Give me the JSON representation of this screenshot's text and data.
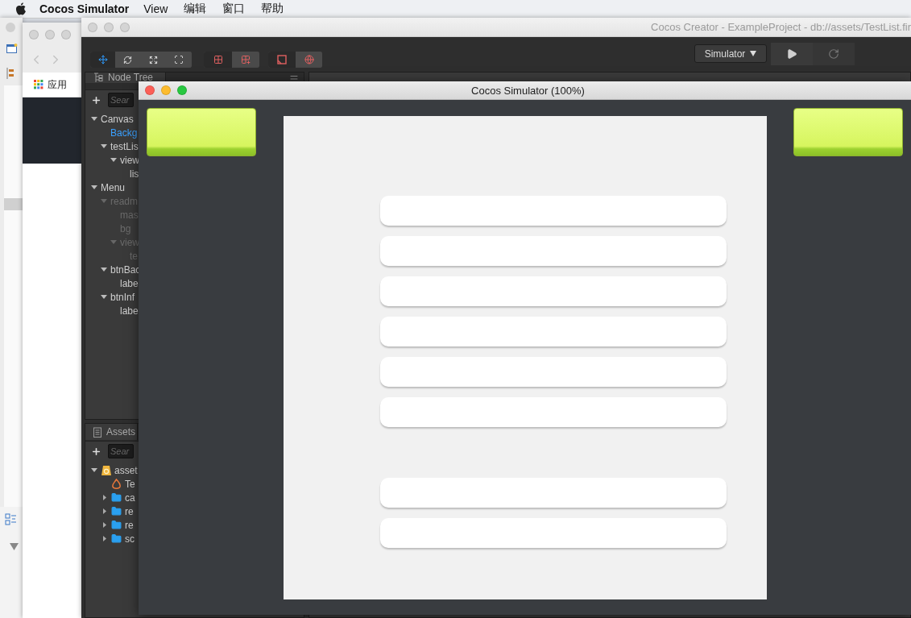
{
  "menu_bar": {
    "app_name": "Cocos Simulator",
    "items": [
      "View",
      "编辑",
      "窗口",
      "帮助"
    ]
  },
  "browser_window": {
    "active": false,
    "bookmark": "应用"
  },
  "editor_window": {
    "active": false,
    "title": "Cocos Creator - ExampleProject - db://assets/TestList.fir",
    "tool_groups": [
      {
        "tools": [
          {
            "kind": "move",
            "selected": true
          },
          {
            "kind": "rotate",
            "selected": false
          },
          {
            "kind": "scale",
            "selected": false
          },
          {
            "kind": "rect",
            "selected": false
          }
        ]
      },
      {
        "tools": [
          {
            "kind": "pivot",
            "selected": true
          },
          {
            "kind": "center",
            "selected": false
          }
        ]
      },
      {
        "tools": [
          {
            "kind": "local",
            "selected": true
          },
          {
            "kind": "global",
            "selected": false
          }
        ]
      }
    ],
    "run_target": "Simulator",
    "node_tree": {
      "title": "Node Tree",
      "search_placeholder": "Sear",
      "nodes": [
        {
          "label": "Canvas",
          "expanded": true,
          "selected": false,
          "disabled": false,
          "children": [
            {
              "label": "Backg",
              "selected": true,
              "disabled": false
            },
            {
              "label": "testLis",
              "expanded": true,
              "selected": false,
              "disabled": false,
              "children": [
                {
                  "label": "view",
                  "expanded": true,
                  "selected": false,
                  "disabled": false,
                  "children": [
                    {
                      "label": "lis",
                      "selected": false,
                      "disabled": false
                    }
                  ]
                }
              ]
            }
          ]
        },
        {
          "label": "Menu",
          "expanded": true,
          "selected": false,
          "disabled": false,
          "children": [
            {
              "label": "readm",
              "expanded": true,
              "selected": false,
              "disabled": true,
              "children": [
                {
                  "label": "mas",
                  "selected": false,
                  "disabled": true
                },
                {
                  "label": "bg",
                  "selected": false,
                  "disabled": true
                },
                {
                  "label": "view",
                  "expanded": true,
                  "selected": false,
                  "disabled": true,
                  "children": [
                    {
                      "label": "te",
                      "selected": false,
                      "disabled": true
                    }
                  ]
                }
              ]
            },
            {
              "label": "btnBac",
              "expanded": true,
              "selected": false,
              "disabled": false,
              "children": [
                {
                  "label": "labe",
                  "selected": false,
                  "disabled": false
                }
              ]
            },
            {
              "label": "btnInf",
              "expanded": true,
              "selected": false,
              "disabled": false,
              "children": [
                {
                  "label": "labe",
                  "selected": false,
                  "disabled": false
                }
              ]
            }
          ]
        }
      ]
    },
    "assets": {
      "title": "Assets",
      "search_placeholder": "Sear",
      "items": [
        {
          "label": "asset",
          "kind": "database",
          "expanded": true,
          "children": [
            {
              "label": "Te",
              "kind": "scene"
            },
            {
              "label": "ca",
              "kind": "folder",
              "expanded": false
            },
            {
              "label": "re",
              "kind": "folder",
              "expanded": false
            },
            {
              "label": "re",
              "kind": "folder",
              "expanded": false
            },
            {
              "label": "sc",
              "kind": "folder",
              "expanded": false
            }
          ]
        }
      ]
    }
  },
  "simulator_window": {
    "active": true,
    "title": "Cocos Simulator (100%)",
    "list_items": [
      {
        "kind": "item"
      },
      {
        "kind": "item"
      },
      {
        "kind": "item"
      },
      {
        "kind": "item"
      },
      {
        "kind": "item"
      },
      {
        "kind": "item"
      },
      {
        "kind": "blank"
      },
      {
        "kind": "item"
      },
      {
        "kind": "item"
      }
    ]
  }
}
